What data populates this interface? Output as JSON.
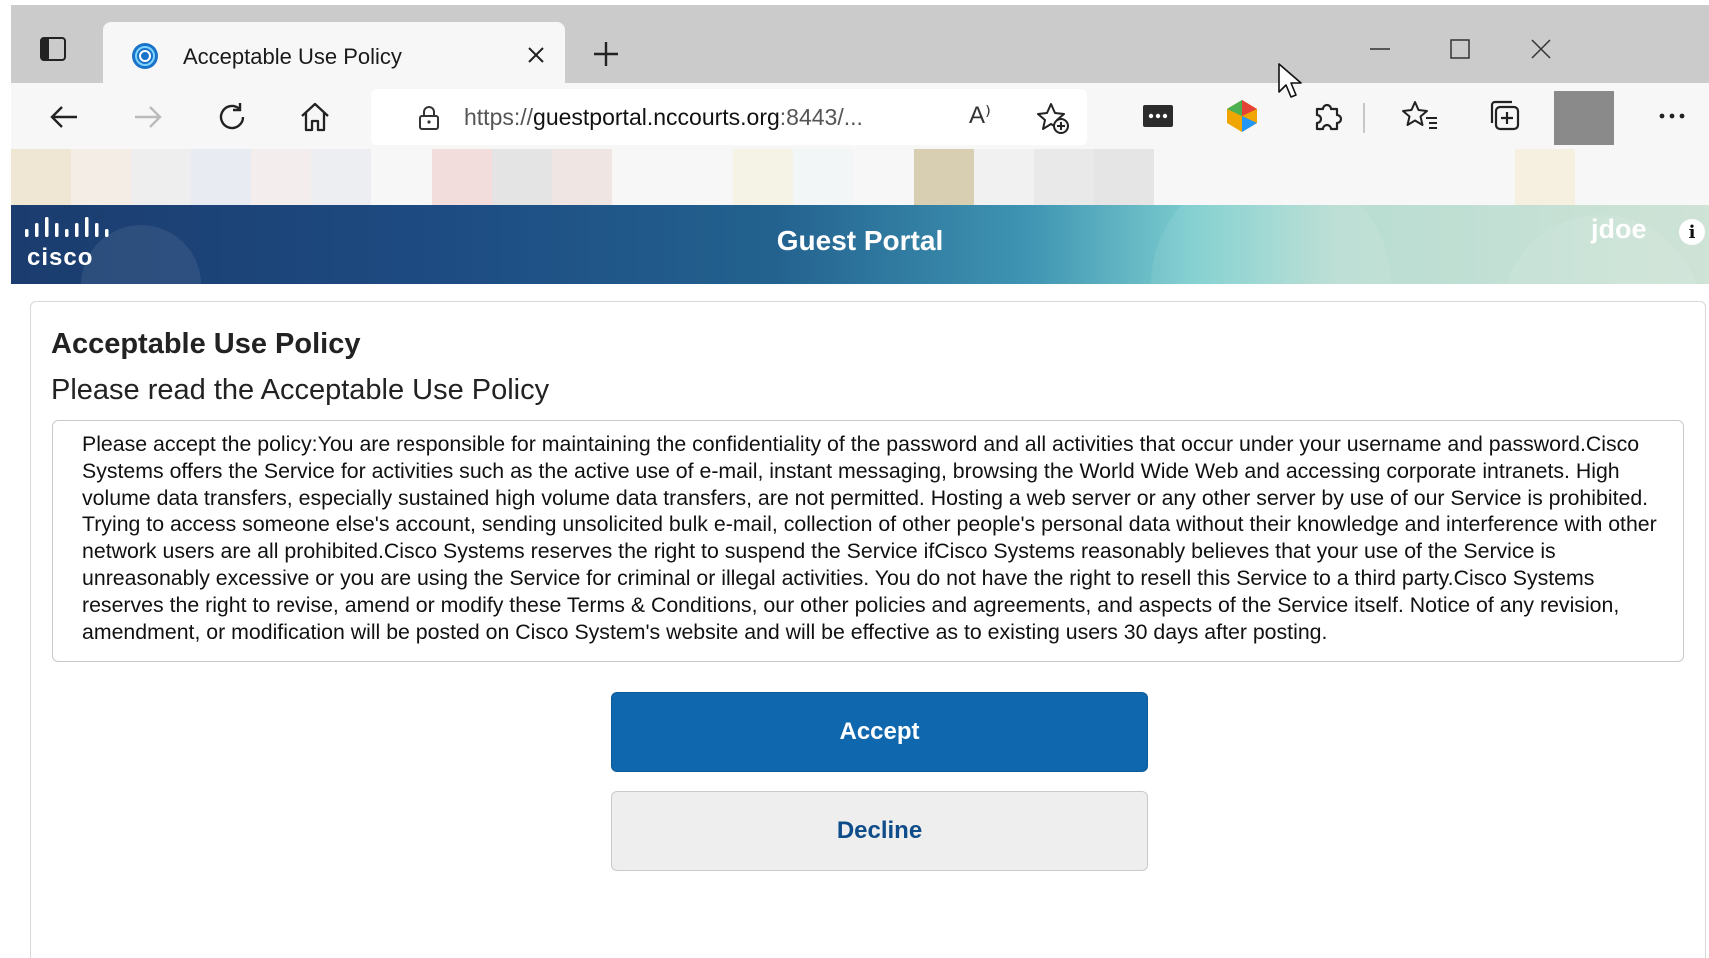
{
  "browser": {
    "tab": {
      "title": "Acceptable Use Policy"
    },
    "address": {
      "url_prefix": "https://",
      "url_host": "guestportal.nccourts.org",
      "url_rest": ":8443/...",
      "read_aloud": "A⁾"
    }
  },
  "banner": {
    "title": "Guest Portal",
    "user": "jdoe",
    "info_glyph": "i"
  },
  "content": {
    "title": "Acceptable Use Policy",
    "subtitle": "Please read the Acceptable Use Policy",
    "policy_text": "Please accept the policy:You are responsible for maintaining the confidentiality of the password and all activities that occur under your username and password.Cisco Systems offers the Service for activities such as the active use of e-mail, instant messaging, browsing the World Wide Web and accessing corporate intranets. High volume data transfers, especially sustained high volume data transfers, are not permitted. Hosting a web server or any other server by use of our Service is prohibited. Trying to access someone else's account, sending unsolicited bulk e-mail, collection of other people's personal data without their knowledge and interference with other network users are all prohibited.Cisco Systems reserves the right to suspend the Service ifCisco Systems reasonably believes that your use of the Service is unreasonably excessive or you are using the Service for criminal or illegal activities. You do not have the right to resell this Service to a third party.Cisco Systems reserves the right to revise, amend or modify these Terms & Conditions, our other policies and agreements, and aspects of the Service itself. Notice of any revision, amendment, or modification will be posted on Cisco System's website and will be effective as to existing users 30 days after posting.",
    "accept_label": "Accept",
    "decline_label": "Decline"
  },
  "colors": {
    "accept_bg": "#0f67ae",
    "decline_text": "#0f4d8a",
    "banner_dark": "#1b3c6e",
    "banner_light": "#cfe3d6"
  },
  "icons": [
    "tab-actions-icon",
    "edge-favicon",
    "close-icon",
    "plus-icon",
    "minimize-icon",
    "maximize-icon",
    "window-close-icon",
    "back-icon",
    "forward-icon",
    "refresh-icon",
    "home-icon",
    "lock-icon",
    "read-aloud-icon",
    "add-favorite-icon",
    "password-extension-icon",
    "color-extension-icon",
    "extensions-icon",
    "favorites-icon",
    "collections-icon",
    "more-icon",
    "info-icon",
    "cursor-icon"
  ]
}
